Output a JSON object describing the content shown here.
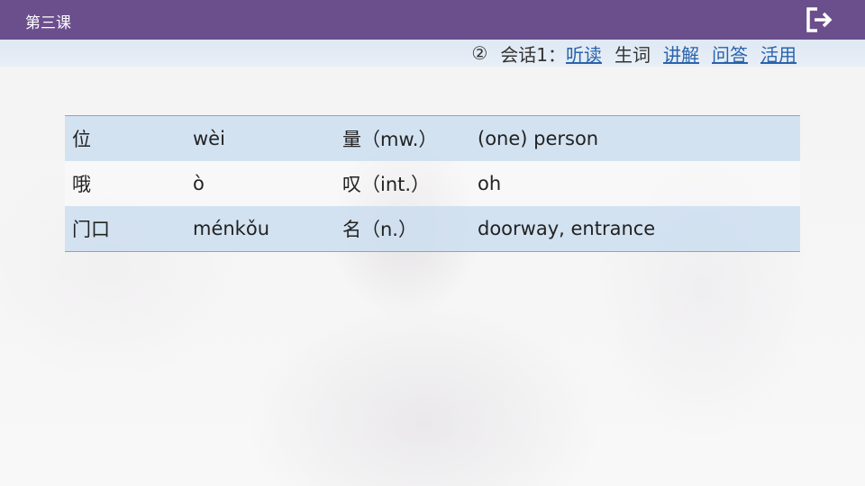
{
  "header": {
    "lesson_title": "第三课"
  },
  "nav": {
    "circle_num": "②",
    "section": "会话1：",
    "items": [
      {
        "label": "听读",
        "link": true
      },
      {
        "label": "生词",
        "link": false
      },
      {
        "label": "讲解",
        "link": true
      },
      {
        "label": "问答",
        "link": true
      },
      {
        "label": "活用",
        "link": true
      }
    ]
  },
  "vocab": {
    "rows": [
      {
        "hanzi": "位",
        "pinyin": "wèi",
        "pos": "量（mw.）",
        "meaning": "(one) person"
      },
      {
        "hanzi": "哦",
        "pinyin": "ò",
        "pos": "叹（int.）",
        "meaning": "oh"
      },
      {
        "hanzi": "门口",
        "pinyin": "ménkǒu",
        "pos": "名（n.）",
        "meaning": "doorway, entrance"
      }
    ]
  },
  "colors": {
    "header_bg": "#6b4f8d",
    "link": "#2a63ad",
    "row_shade": "#cddef0"
  }
}
